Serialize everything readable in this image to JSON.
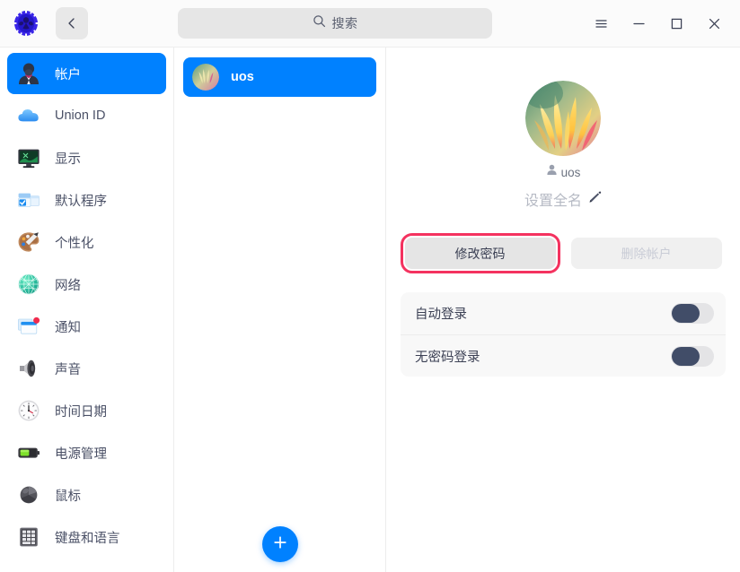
{
  "titlebar": {
    "logo_icon": "deepin-settings-logo-icon",
    "back_icon": "chevron-left-icon",
    "menu_icon": "hamburger-menu-icon",
    "minimize_icon": "minimize-icon",
    "maximize_icon": "maximize-icon",
    "close_icon": "close-icon",
    "search": {
      "icon": "search-icon",
      "placeholder": "搜索",
      "value": ""
    }
  },
  "sidebar": {
    "items": [
      {
        "label": "帐户",
        "icon": "account-person-icon",
        "active": true
      },
      {
        "label": "Union ID",
        "icon": "cloud-icon",
        "active": false
      },
      {
        "label": "显示",
        "icon": "monitor-display-icon",
        "active": false
      },
      {
        "label": "默认程序",
        "icon": "default-apps-icon",
        "active": false
      },
      {
        "label": "个性化",
        "icon": "palette-personalization-icon",
        "active": false
      },
      {
        "label": "网络",
        "icon": "globe-network-icon",
        "active": false
      },
      {
        "label": "通知",
        "icon": "notification-window-icon",
        "active": false
      },
      {
        "label": "声音",
        "icon": "speaker-sound-icon",
        "active": false
      },
      {
        "label": "时间日期",
        "icon": "clock-datetime-icon",
        "active": false
      },
      {
        "label": "电源管理",
        "icon": "battery-power-icon",
        "active": false
      },
      {
        "label": "鼠标",
        "icon": "mouse-icon",
        "active": false
      },
      {
        "label": "键盘和语言",
        "icon": "keyboard-language-icon",
        "active": false
      }
    ]
  },
  "userlist": {
    "users": [
      {
        "name": "uos",
        "avatar_icon": "user-avatar-flower-icon",
        "selected": true
      }
    ],
    "add_button": {
      "icon": "plus-icon",
      "label": ""
    }
  },
  "main": {
    "avatar_icon": "user-avatar-flower-large-icon",
    "username_icon": "person-small-icon",
    "username": "uos",
    "fullname_placeholder": "设置全名",
    "fullname_edit_icon": "pencil-edit-icon",
    "buttons": [
      {
        "label": "修改密码",
        "disabled": false,
        "highlighted": true
      },
      {
        "label": "删除帐户",
        "disabled": true,
        "highlighted": false
      }
    ],
    "settings": [
      {
        "label": "自动登录",
        "enabled": false
      },
      {
        "label": "无密码登录",
        "enabled": false
      }
    ]
  },
  "colors": {
    "accent": "#0081ff",
    "highlight_box": "#f4325f",
    "toggle_knob": "#414d68",
    "toggle_track": "#e4e4e6",
    "text_primary": "#3b4054",
    "text_muted": "#b6bac4"
  }
}
